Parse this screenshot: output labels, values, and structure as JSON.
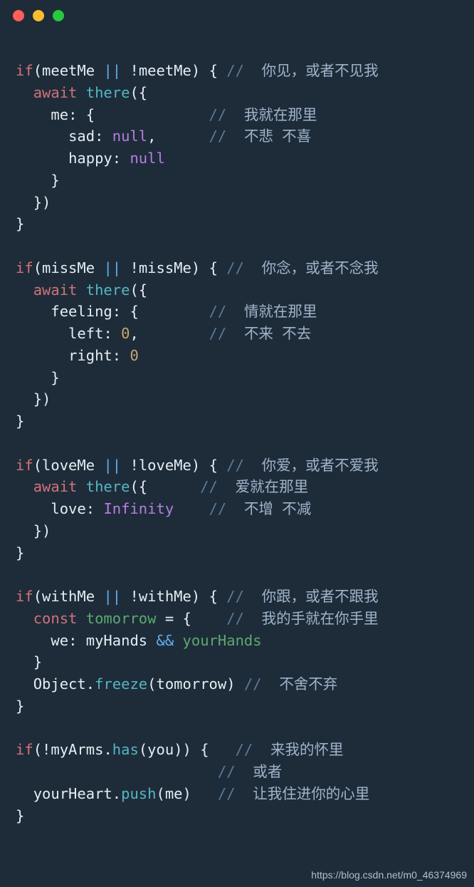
{
  "window": {
    "dot_red": "#ff5f56",
    "dot_yellow": "#ffbd2e",
    "dot_green": "#27c93f"
  },
  "tok": {
    "kw_if": "if",
    "kw_await": "await",
    "kw_const": "const",
    "kw_null": "null",
    "kw_inf": "Infinity",
    "meetMe": "meetMe",
    "missMe": "missMe",
    "loveMe": "loveMe",
    "withMe": "withMe",
    "there": "there",
    "me": "me",
    "sad": "sad",
    "happy": "happy",
    "feeling": "feeling",
    "left": "left",
    "right": "right",
    "love": "love",
    "tomorrow": "tomorrow",
    "we": "we",
    "myHands": "myHands",
    "yourHands": "yourHands",
    "Object": "Object",
    "freeze": "freeze",
    "myArms": "myArms",
    "has": "has",
    "you": "you",
    "yourHeart": "yourHeart",
    "push": "push",
    "me2": "me",
    "zero": "0",
    "or": "||",
    "and": "&&",
    "not": "!",
    "slashes": "//"
  },
  "comments": {
    "c1": "你见，或者不见我",
    "c2": "我就在那里",
    "c3": "不悲 不喜",
    "c4": "你念，或者不念我",
    "c5": "情就在那里",
    "c6": "不来 不去",
    "c7": "你爱，或者不爱我",
    "c8": "爱就在那里",
    "c9": "不增 不减",
    "c10": "你跟，或者不跟我",
    "c11": "我的手就在你手里",
    "c12": "不舍不弃",
    "c13": "来我的怀里",
    "c14": "或者",
    "c15": "让我住进你的心里"
  },
  "watermark": "https://blog.csdn.net/m0_46374969"
}
